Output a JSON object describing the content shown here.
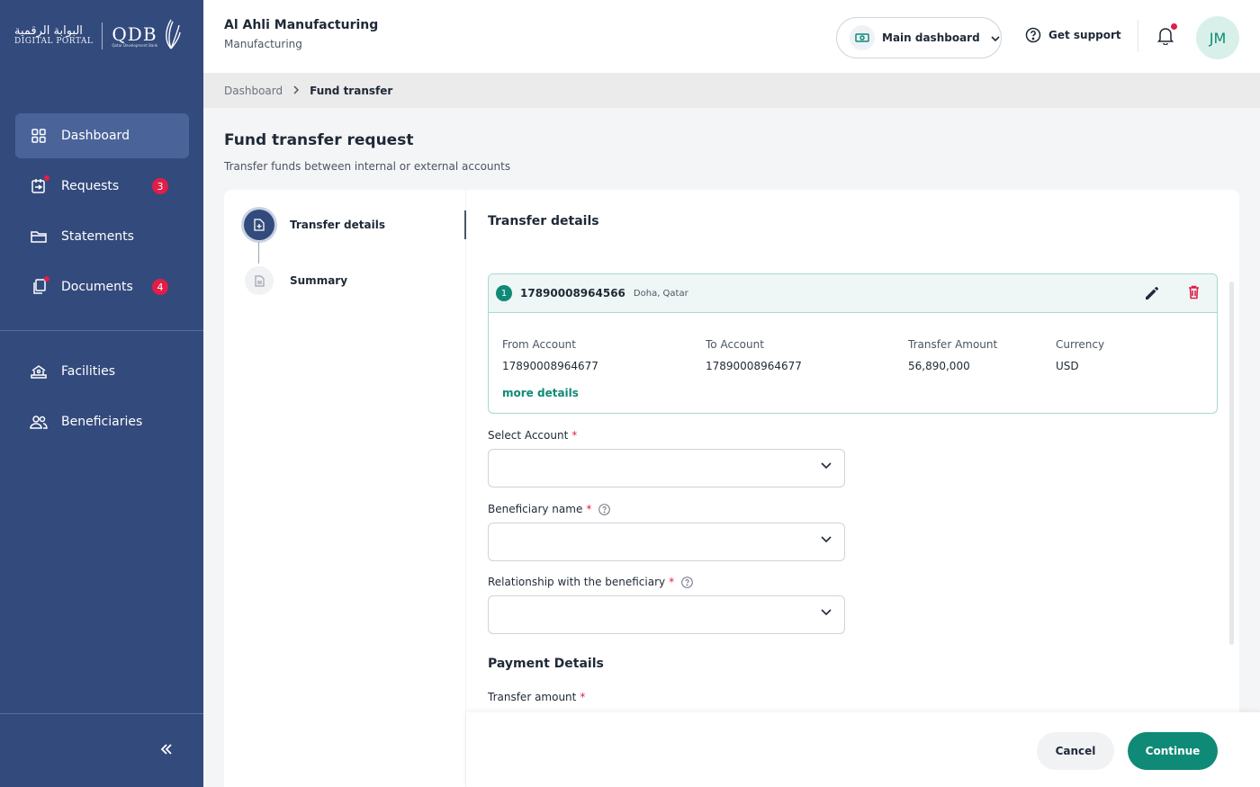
{
  "brand": {
    "arabic": "البوابة الرقمية",
    "portal": "DIGITAL PORTAL",
    "qdb": "QDB",
    "qdb_sub": "Qatar Development Bank"
  },
  "sidebar": {
    "items": [
      {
        "label": "Dashboard",
        "icon": "grid-icon",
        "active": true
      },
      {
        "label": "Requests",
        "icon": "requests-icon",
        "badge": "3"
      },
      {
        "label": "Statements",
        "icon": "folder-icon"
      },
      {
        "label": "Documents",
        "icon": "documents-icon",
        "badge": "4"
      }
    ],
    "items2": [
      {
        "label": "Facilities",
        "icon": "facilities-icon"
      },
      {
        "label": "Beneficiaries",
        "icon": "users-icon"
      }
    ],
    "collapse_icon": "double-chevron-left-icon"
  },
  "header": {
    "company": "Al Ahli Manufacturing",
    "industry": "Manufacturing",
    "main_dashboard": "Main dashboard",
    "support": "Get support",
    "avatar": "JM"
  },
  "breadcrumb": {
    "root": "Dashboard",
    "current": "Fund transfer"
  },
  "page": {
    "title": "Fund transfer request",
    "subtitle": "Transfer funds between internal or external accounts"
  },
  "steps": [
    {
      "label": "Transfer details"
    },
    {
      "label": "Summary"
    }
  ],
  "form": {
    "section_title": "Transfer details",
    "item": {
      "index": "1",
      "account": "17890008964566",
      "location": "Doha, Qatar",
      "from_label": "From Account",
      "from_value": "17890008964677",
      "to_label": "To Account",
      "to_value": "17890008964677",
      "amount_label": "Transfer Amount",
      "amount_value": "56,890,000",
      "currency_label": "Currency",
      "currency_value": "USD",
      "more": "more details"
    },
    "select_account": "Select Account",
    "beneficiary_name": "Beneficiary name",
    "relationship": "Relationship with the beneficiary",
    "payment_details": "Payment Details",
    "transfer_amount": "Transfer amount",
    "required_mark": "*"
  },
  "footer": {
    "cancel": "Cancel",
    "continue": "Continue"
  },
  "colors": {
    "sidebar": "#334a7c",
    "accent": "#0f8a76",
    "danger": "#e11d48"
  }
}
